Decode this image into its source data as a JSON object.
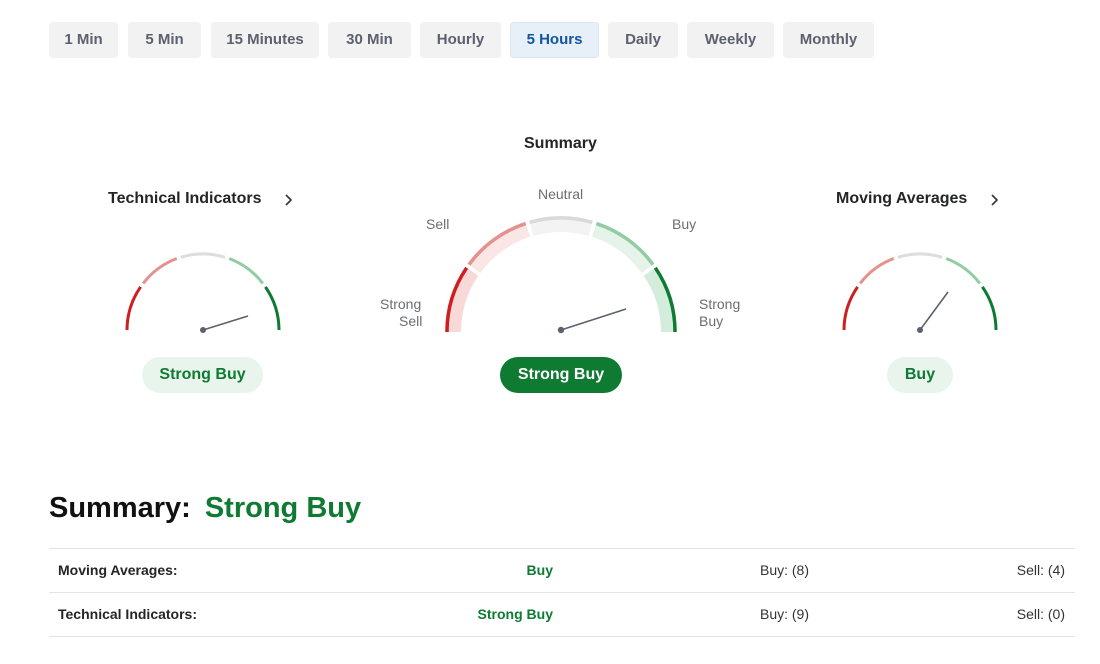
{
  "timeframes": {
    "items": [
      {
        "label": "1 Min"
      },
      {
        "label": "5 Min"
      },
      {
        "label": "15 Minutes"
      },
      {
        "label": "30 Min"
      },
      {
        "label": "Hourly"
      },
      {
        "label": "5 Hours",
        "active": true
      },
      {
        "label": "Daily"
      },
      {
        "label": "Weekly"
      },
      {
        "label": "Monthly"
      }
    ]
  },
  "technical_indicators": {
    "title": "Technical Indicators",
    "result": "Strong Buy"
  },
  "summary_gauge": {
    "title": "Summary",
    "labels": {
      "strong_sell_1": "Strong",
      "strong_sell_2": "Sell",
      "sell": "Sell",
      "neutral": "Neutral",
      "buy": "Buy",
      "strong_buy_1": "Strong",
      "strong_buy_2": "Buy"
    },
    "result": "Strong Buy"
  },
  "moving_averages": {
    "title": "Moving Averages",
    "result": "Buy"
  },
  "summary": {
    "label": "Summary:",
    "value": "Strong Buy",
    "rows": [
      {
        "name": "Moving Averages:",
        "signal": "Buy",
        "buy": "Buy: (8)",
        "sell": "Sell: (4)"
      },
      {
        "name": "Technical Indicators:",
        "signal": "Strong Buy",
        "buy": "Buy: (9)",
        "sell": "Sell: (0)"
      }
    ]
  },
  "colors": {
    "strong_sell": "#cc1f1f",
    "sell": "#e3928d",
    "neutral": "#dddddd",
    "buy": "#92cca2",
    "strong_buy": "#0e7a32",
    "needle": "#5b616e"
  }
}
